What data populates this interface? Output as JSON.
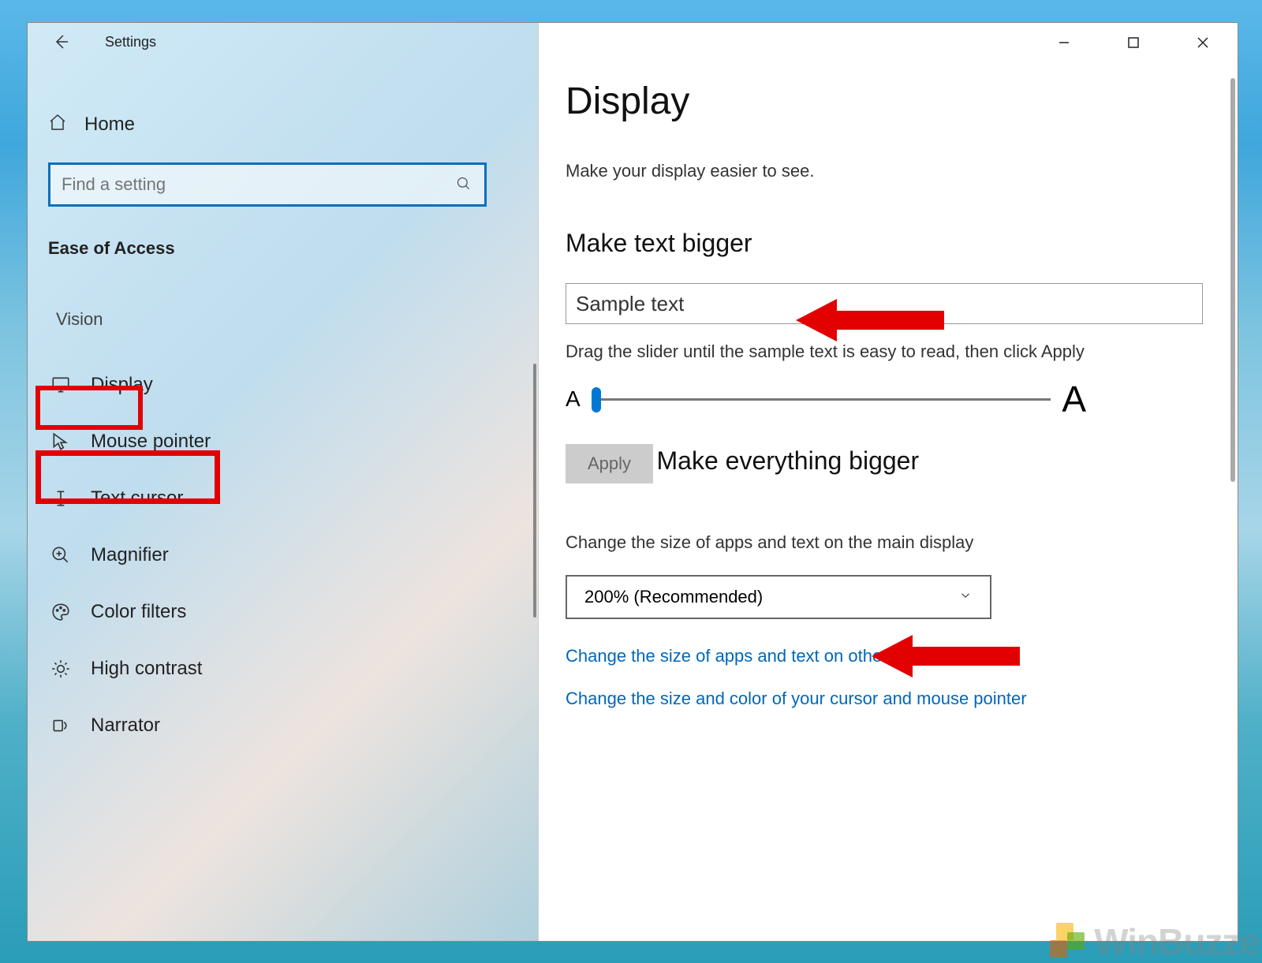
{
  "app_title": "Settings",
  "sidebar": {
    "home": "Home",
    "search_placeholder": "Find a setting",
    "section": "Ease of Access",
    "subcat": "Vision",
    "items": [
      {
        "label": "Display"
      },
      {
        "label": "Mouse pointer"
      },
      {
        "label": "Text cursor"
      },
      {
        "label": "Magnifier"
      },
      {
        "label": "Color filters"
      },
      {
        "label": "High contrast"
      },
      {
        "label": "Narrator"
      }
    ]
  },
  "main": {
    "title": "Display",
    "subtitle": "Make your display easier to see.",
    "section1": "Make text bigger",
    "sample_text": "Sample text",
    "slider_hint": "Drag the slider until the sample text is easy to read, then click Apply",
    "apply": "Apply",
    "section2": "Make everything bigger",
    "desc2": "Change the size of apps and text on the main display",
    "dropdown": "200% (Recommended)",
    "link1": "Change the size of apps and text on other displays",
    "link2": "Change the size and color of your cursor and mouse pointer"
  },
  "watermark": "WinBuzze"
}
